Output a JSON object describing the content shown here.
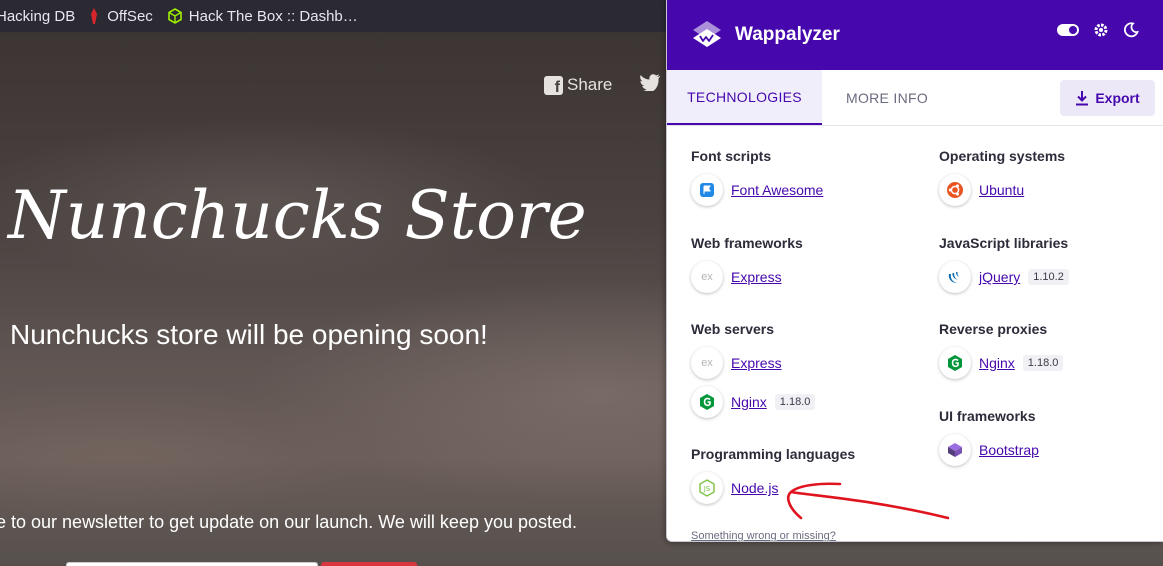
{
  "bookmarks": [
    {
      "label": "Hacking DB",
      "icon": "exploit-db-icon"
    },
    {
      "label": "OffSec",
      "icon": "offsec-icon"
    },
    {
      "label": "Hack The Box :: Dashb…",
      "icon": "htb-icon"
    }
  ],
  "site": {
    "share_label": "Share",
    "title": "Nunchucks Store",
    "subtitle": "Nunchucks store will be opening soon!",
    "newsletter": "e to our newsletter to get update on our launch. We will keep you posted."
  },
  "wappalyzer": {
    "brand": "Wappalyzer",
    "tabs": {
      "technologies": "TECHNOLOGIES",
      "more_info": "MORE INFO"
    },
    "export_label": "Export",
    "categories": {
      "font_scripts": "Font scripts",
      "web_frameworks": "Web frameworks",
      "web_servers": "Web servers",
      "programming_languages": "Programming languages",
      "operating_systems": "Operating systems",
      "javascript_libraries": "JavaScript libraries",
      "reverse_proxies": "Reverse proxies",
      "ui_frameworks": "UI frameworks"
    },
    "techs": {
      "font_awesome": {
        "name": "Font Awesome",
        "icon": "font-awesome-icon"
      },
      "express_fw": {
        "name": "Express",
        "icon": "express-icon"
      },
      "express_ws": {
        "name": "Express",
        "icon": "express-icon"
      },
      "nginx_ws": {
        "name": "Nginx",
        "version": "1.18.0",
        "icon": "nginx-icon"
      },
      "nodejs": {
        "name": "Node.js",
        "icon": "nodejs-icon"
      },
      "ubuntu": {
        "name": "Ubuntu",
        "icon": "ubuntu-icon"
      },
      "jquery": {
        "name": "jQuery",
        "version": "1.10.2",
        "icon": "jquery-icon"
      },
      "nginx_rp": {
        "name": "Nginx",
        "version": "1.18.0",
        "icon": "nginx-icon"
      },
      "bootstrap": {
        "name": "Bootstrap",
        "icon": "bootstrap-icon"
      }
    },
    "missing_link": "Something wrong or missing?"
  },
  "colors": {
    "wappalyzer_purple": "#4608ad",
    "annotation_red": "#e0141e",
    "subscribe_red": "#d9363e"
  }
}
